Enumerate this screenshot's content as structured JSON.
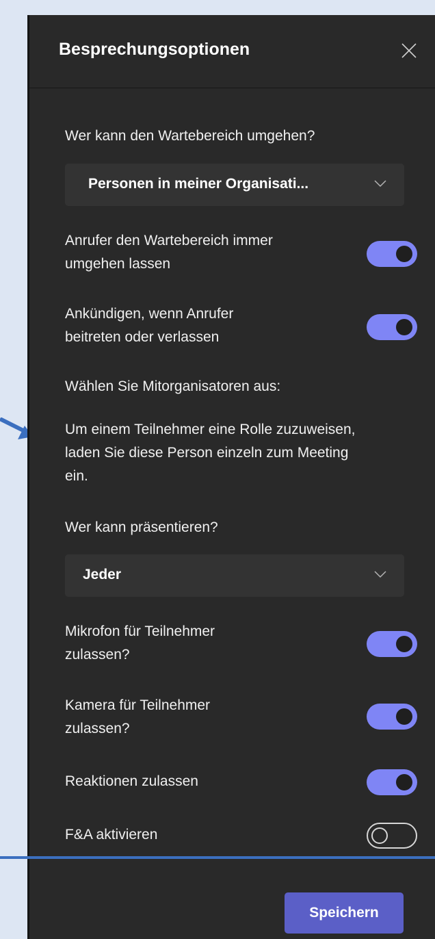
{
  "header": {
    "title": "Besprechungsoptionen"
  },
  "lobby": {
    "question": "Wer kann den Wartebereich umgehen?",
    "selected": "Personen in meiner Organisati..."
  },
  "toggles": {
    "callers_bypass": {
      "line1": "Anrufer den Wartebereich immer",
      "line2": "umgehen lassen",
      "on": true
    },
    "announce": {
      "line1": "Ankündigen, wenn Anrufer",
      "line2": "beitreten oder verlassen",
      "on": true
    }
  },
  "coorganizers": {
    "label": "Wählen Sie Mitorganisatoren aus:",
    "info_line1": "Um einem Teilnehmer eine Rolle zuzuweisen,",
    "info_line2": "laden Sie diese Person einzeln zum Meeting",
    "info_line3": "ein."
  },
  "presenters": {
    "question": "Wer kann präsentieren?",
    "selected": "Jeder"
  },
  "permissions": {
    "mic": {
      "line1": "Mikrofon für Teilnehmer",
      "line2": "zulassen?",
      "on": true
    },
    "camera": {
      "line1": "Kamera für Teilnehmer",
      "line2": "zulassen?",
      "on": true
    },
    "reactions": {
      "label": "Reaktionen zulassen",
      "on": true
    },
    "qa": {
      "label": "F&A aktivieren",
      "on": false
    }
  },
  "footer": {
    "save_label": "Speichern"
  },
  "colors": {
    "accent": "#7f85f5",
    "button": "#5b5fc7",
    "panel": "#292929",
    "annotation": "#3b6fbf"
  },
  "icons": {
    "close": "close-icon",
    "dropdown": "chevron-down-icon",
    "pointer": "annotation-arrow-icon"
  }
}
